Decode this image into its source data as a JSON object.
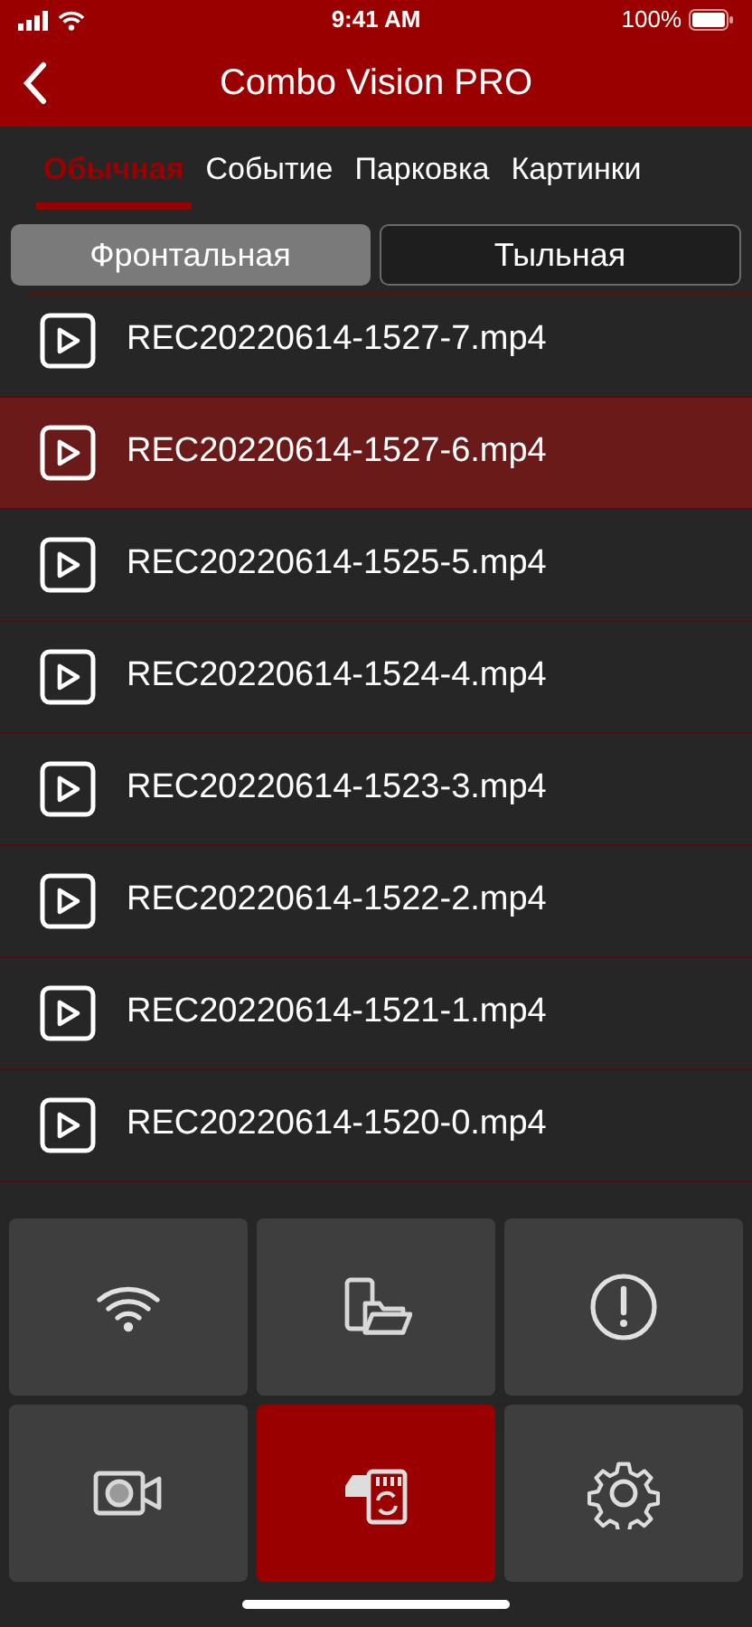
{
  "status_bar": {
    "time": "9:41 AM",
    "battery": "100%"
  },
  "nav_bar": {
    "title": "Combo Vision PRO"
  },
  "tabs": [
    {
      "label": "Обычная",
      "selected": true
    },
    {
      "label": "Событие",
      "selected": false
    },
    {
      "label": "Парковка",
      "selected": false
    },
    {
      "label": "Картинки",
      "selected": false
    }
  ],
  "camera_toggle": [
    {
      "label": "Фронтальная",
      "selected": true
    },
    {
      "label": "Тыльная",
      "selected": false
    }
  ],
  "files": [
    {
      "name": "REC20220614-1527-7.mp4",
      "selected": false
    },
    {
      "name": "REC20220614-1527-6.mp4",
      "selected": true
    },
    {
      "name": "REC20220614-1525-5.mp4",
      "selected": false
    },
    {
      "name": "REC20220614-1524-4.mp4",
      "selected": false
    },
    {
      "name": "REC20220614-1523-3.mp4",
      "selected": false
    },
    {
      "name": "REC20220614-1522-2.mp4",
      "selected": false
    },
    {
      "name": "REC20220614-1521-1.mp4",
      "selected": false
    },
    {
      "name": "REC20220614-1520-0.mp4",
      "selected": false
    }
  ],
  "toolbar": [
    {
      "kind": "wifi",
      "selected": false
    },
    {
      "kind": "files",
      "selected": false
    },
    {
      "kind": "alert",
      "selected": false
    },
    {
      "kind": "camera",
      "selected": false
    },
    {
      "kind": "sdcard",
      "selected": true
    },
    {
      "kind": "settings",
      "selected": false
    }
  ]
}
